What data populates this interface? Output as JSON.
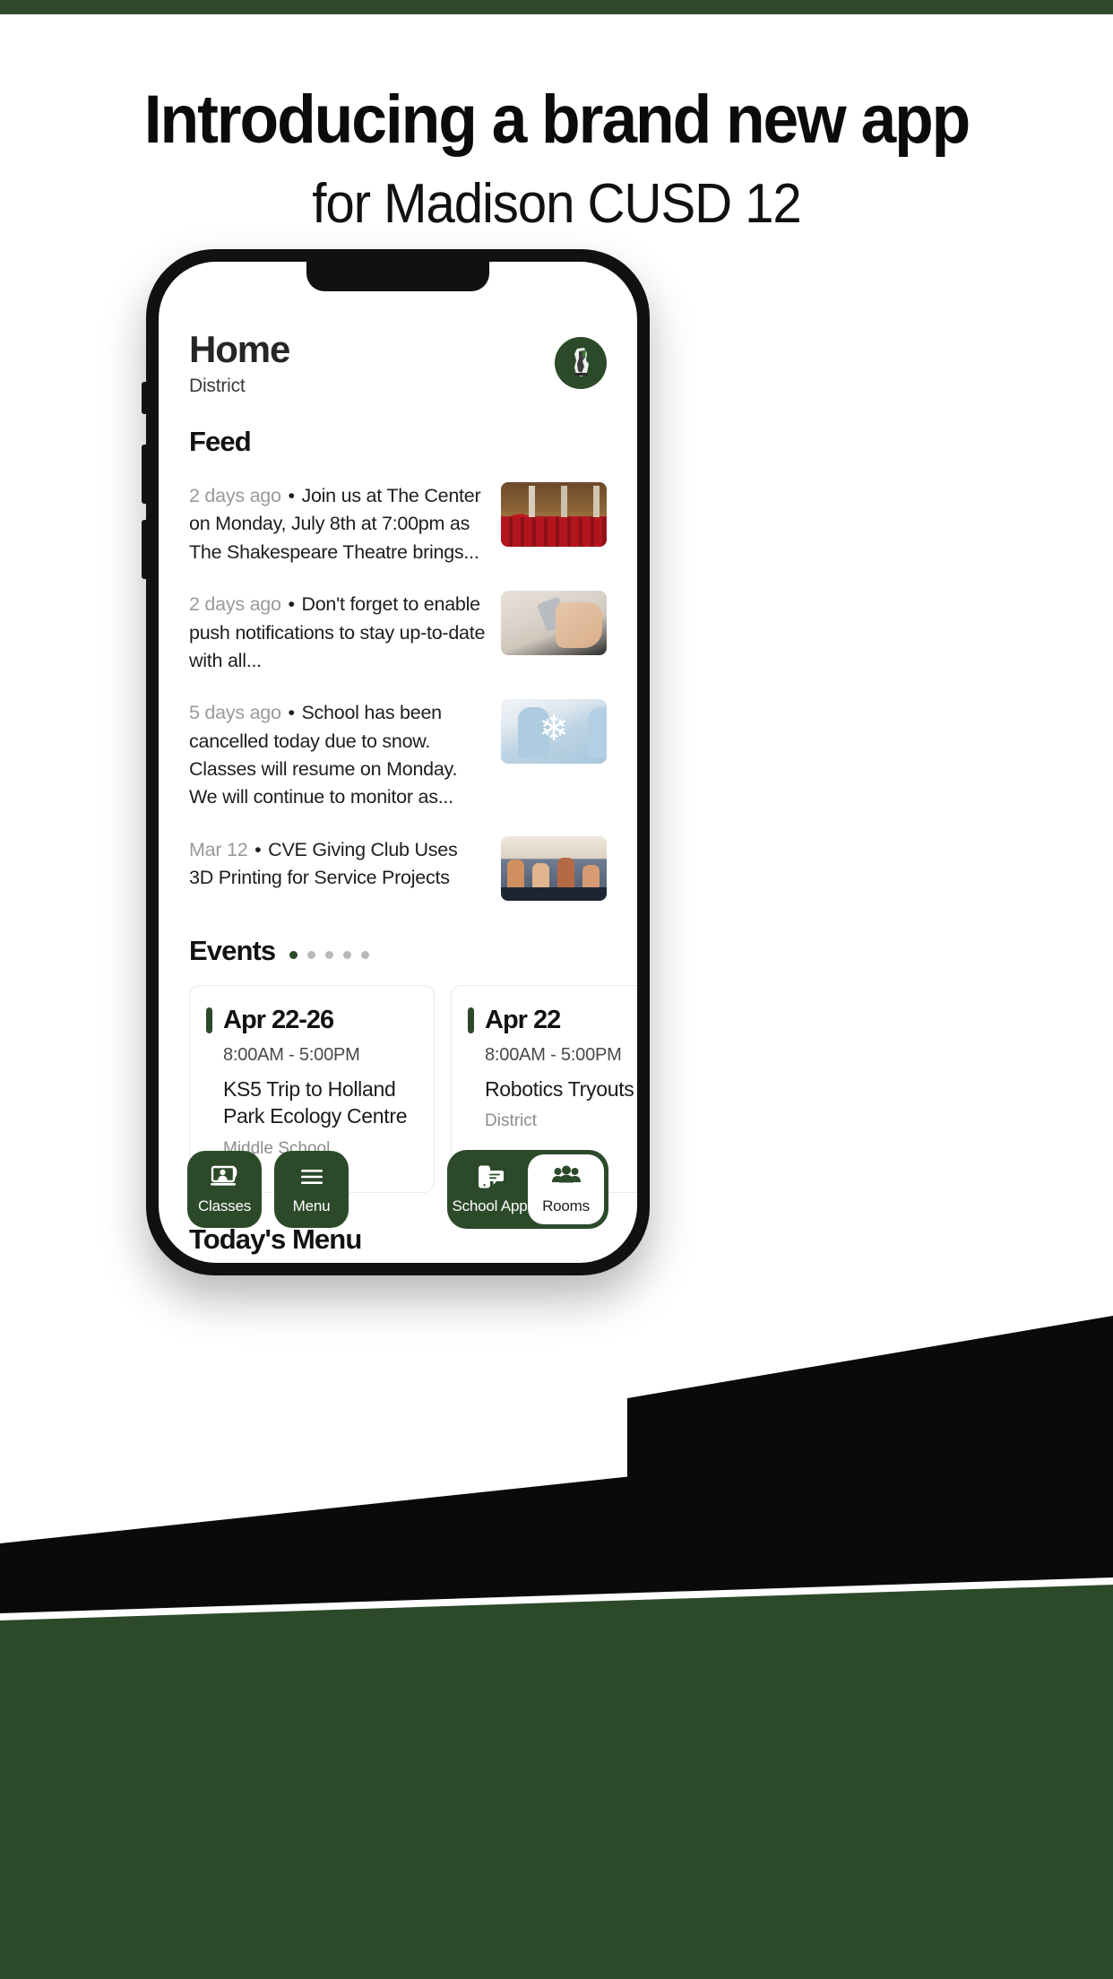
{
  "promo": {
    "headline_line1": "Introducing a brand new app",
    "headline_line2": "for Madison CUSD 12"
  },
  "theme": {
    "brand_green": "#2C4A2A",
    "accent_dot_active": "#2C4A2A",
    "bezel_black": "#111111"
  },
  "app": {
    "header": {
      "title": "Home",
      "subtitle": "District",
      "logo_name": "madison-cusd-trojan-logo"
    },
    "feed": {
      "heading": "Feed",
      "items": [
        {
          "date": "2 days ago",
          "separator": "•",
          "text": "Join us at The Center on Monday, July 8th at 7:00pm as The Shakespeare Theatre brings...",
          "thumb_name": "theatre-seats-photo"
        },
        {
          "date": "2 days ago",
          "separator": "•",
          "text": "Don't forget to enable push notifications to stay up-to-date with all...",
          "thumb_name": "phone-in-hands-photo"
        },
        {
          "date": "5 days ago",
          "separator": "•",
          "text": "School has been cancelled today due to snow. Classes will resume on Monday. We will continue to monitor as...",
          "thumb_name": "snowflake-mittens-photo"
        },
        {
          "date": "Mar 12",
          "separator": "•",
          "text": "CVE Giving Club Uses 3D Printing for Service Projects",
          "thumb_name": "classroom-students-photo"
        }
      ]
    },
    "events": {
      "heading": "Events",
      "pagination_dots": 5,
      "active_dot_index": 0,
      "cards": [
        {
          "date": "Apr 22-26",
          "time": "8:00AM  -  5:00PM",
          "title": "KS5 Trip to Holland Park Ecology Centre",
          "org": "Middle School"
        },
        {
          "date": "Apr 22",
          "time": "8:00AM  -  5:00PM",
          "title": "Robotics Tryouts",
          "org": "District"
        }
      ]
    },
    "menu": {
      "heading": "Today's Menu"
    },
    "bottom_nav": {
      "left_items": [
        {
          "label": "Classes",
          "icon": "student-raising-hand-icon",
          "active": false
        },
        {
          "label": "Menu",
          "icon": "hamburger-menu-icon",
          "active": false
        }
      ],
      "right_items": [
        {
          "label": "School App",
          "icon": "phone-chat-icon",
          "active": false
        },
        {
          "label": "Rooms",
          "icon": "people-group-icon",
          "active": true
        }
      ]
    }
  }
}
